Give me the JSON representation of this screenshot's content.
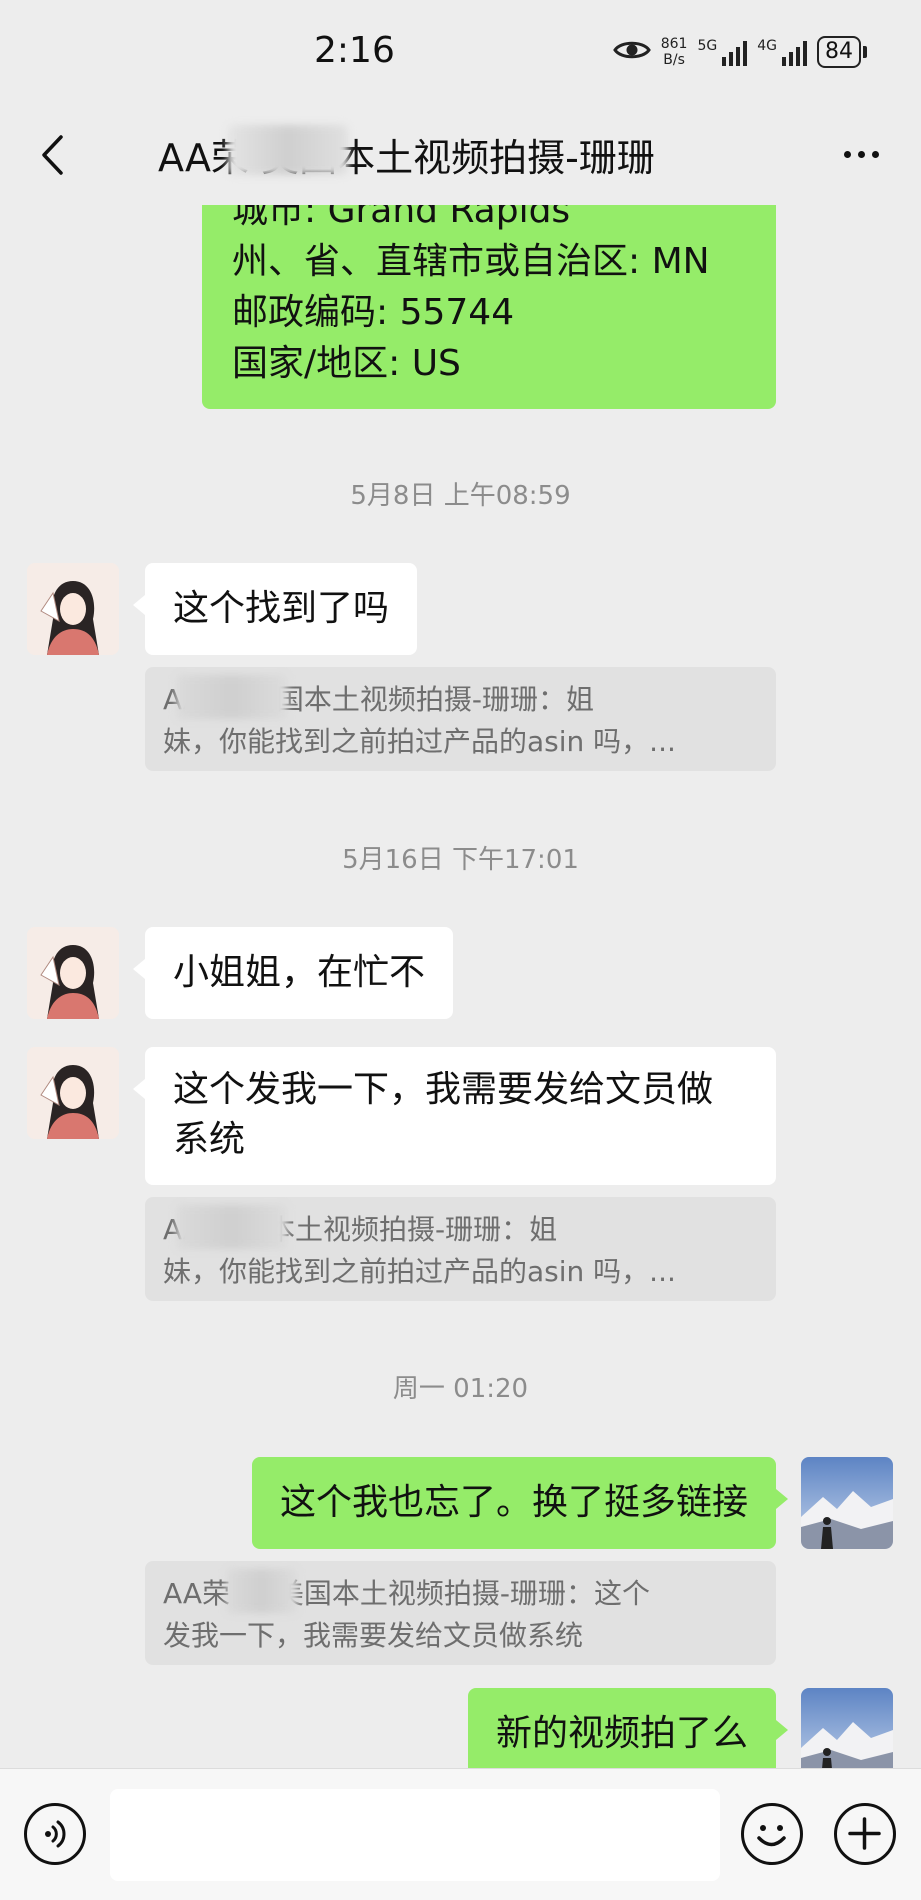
{
  "status": {
    "time": "2:16",
    "net_speed_value": "861",
    "net_speed_unit": "B/s",
    "sig1_label": "5G",
    "sig2_label": "4G",
    "battery": "84"
  },
  "header": {
    "title": "AA荣 美国本土视频拍摄-珊珊"
  },
  "messages": {
    "address_lines": [
      "城市: Grand Rapids",
      "州、省、直辖市或自治区: MN",
      "邮政编码: 55744",
      "国家/地区: US"
    ],
    "ts1": "5月8日 上午08:59",
    "m1": "这个找到了吗",
    "q1_line1": "AA 通 美国本土视频拍摄-珊珊：姐",
    "q1_line2": "妹，你能找到之前拍过产品的asin 吗，...",
    "ts2": "5月16日 下午17:01",
    "m2": "小姐姐，在忙不",
    "m3_line1": "这个发我一下，我需要发给文员做",
    "m3_line2": "系统",
    "q2_line1": "AA 美国本土视频拍摄-珊珊：姐",
    "q2_line2": "妹，你能找到之前拍过产品的asin 吗，...",
    "ts3": "周一 01:20",
    "m4": "这个我也忘了。换了挺多链接",
    "q3_line1": "AA荣 通 美国本土视频拍摄-珊珊：这个",
    "q3_line2": "发我一下，我需要发给文员做系统",
    "m5": "新的视频拍了么"
  },
  "input": {
    "placeholder": ""
  },
  "colors": {
    "outgoing_bubble": "#95ec69",
    "incoming_bubble": "#ffffff",
    "background": "#ededed"
  },
  "icons": [
    "eye-icon",
    "signal-icon",
    "battery-icon",
    "back-arrow-icon",
    "more-icon",
    "voice-icon",
    "emoji-icon",
    "plus-icon"
  ]
}
